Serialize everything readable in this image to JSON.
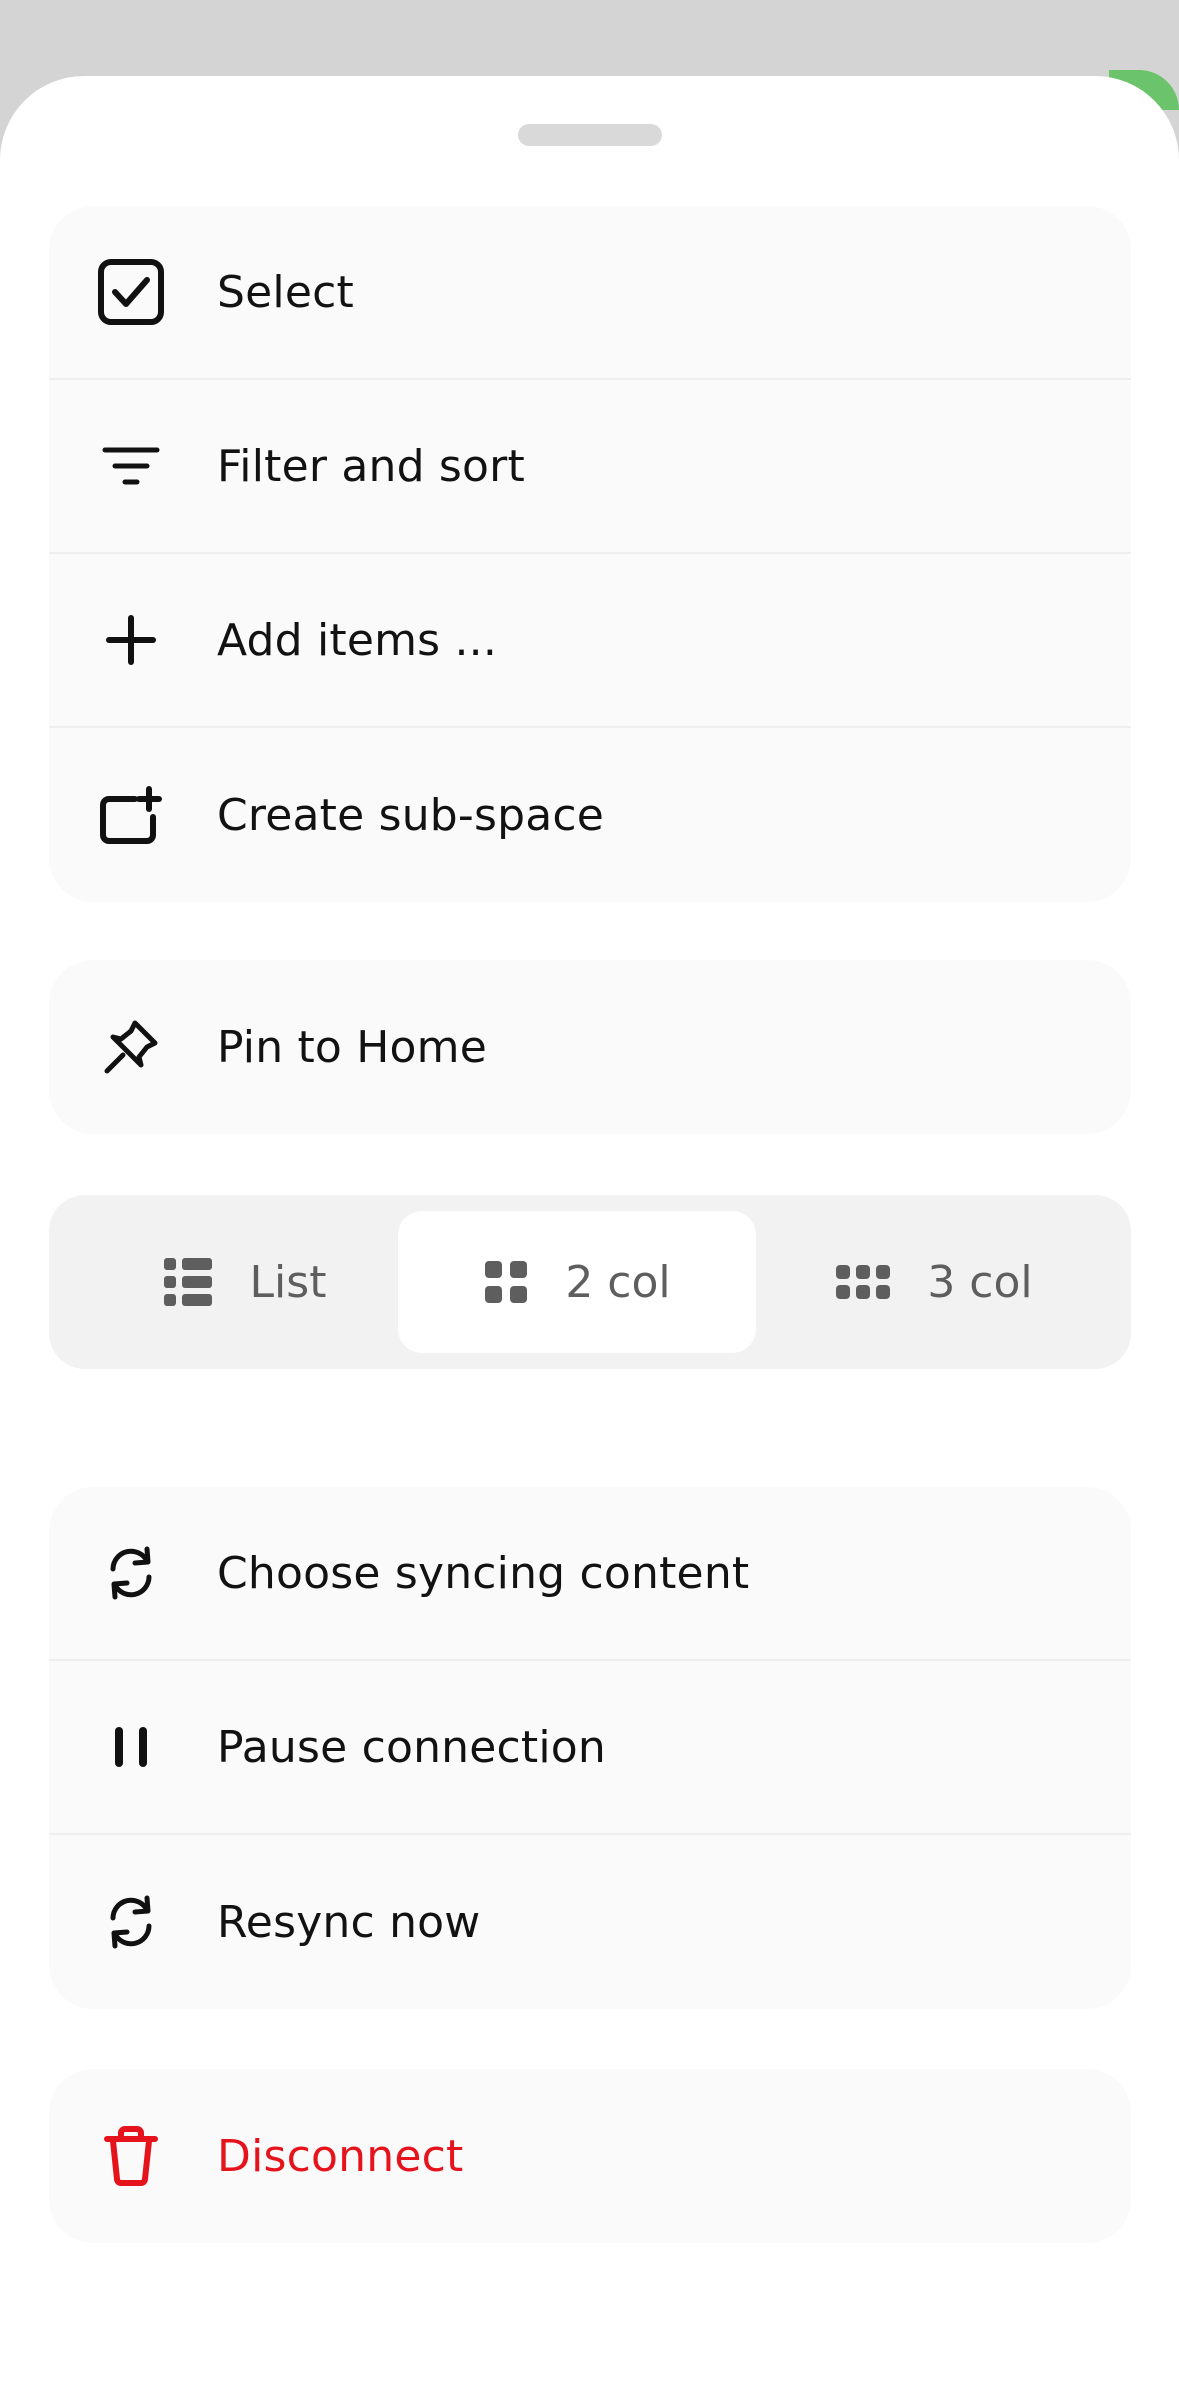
{
  "sheet": {
    "groups": [
      {
        "items": [
          {
            "label": "Select",
            "icon": "checkbox-checked-icon"
          },
          {
            "label": "Filter and sort",
            "icon": "filter-icon"
          },
          {
            "label": "Add items ...",
            "icon": "plus-icon"
          },
          {
            "label": "Create sub-space",
            "icon": "folder-plus-icon"
          }
        ]
      },
      {
        "items": [
          {
            "label": "Pin to Home",
            "icon": "pin-icon"
          }
        ]
      }
    ],
    "layout_toggle": {
      "options": [
        {
          "label": "List",
          "icon": "list-icon"
        },
        {
          "label": "2 col",
          "icon": "grid-2-icon"
        },
        {
          "label": "3 col",
          "icon": "grid-3-icon"
        }
      ],
      "selected": "2 col"
    },
    "sync_group": {
      "items": [
        {
          "label": "Choose syncing content",
          "icon": "sync-icon"
        },
        {
          "label": "Pause connection",
          "icon": "pause-icon"
        },
        {
          "label": "Resync now",
          "icon": "sync-icon"
        }
      ]
    },
    "danger_group": {
      "items": [
        {
          "label": "Disconnect",
          "icon": "trash-icon"
        }
      ]
    }
  },
  "colors": {
    "danger": "#e5141c",
    "accent": "#6bc46b"
  }
}
